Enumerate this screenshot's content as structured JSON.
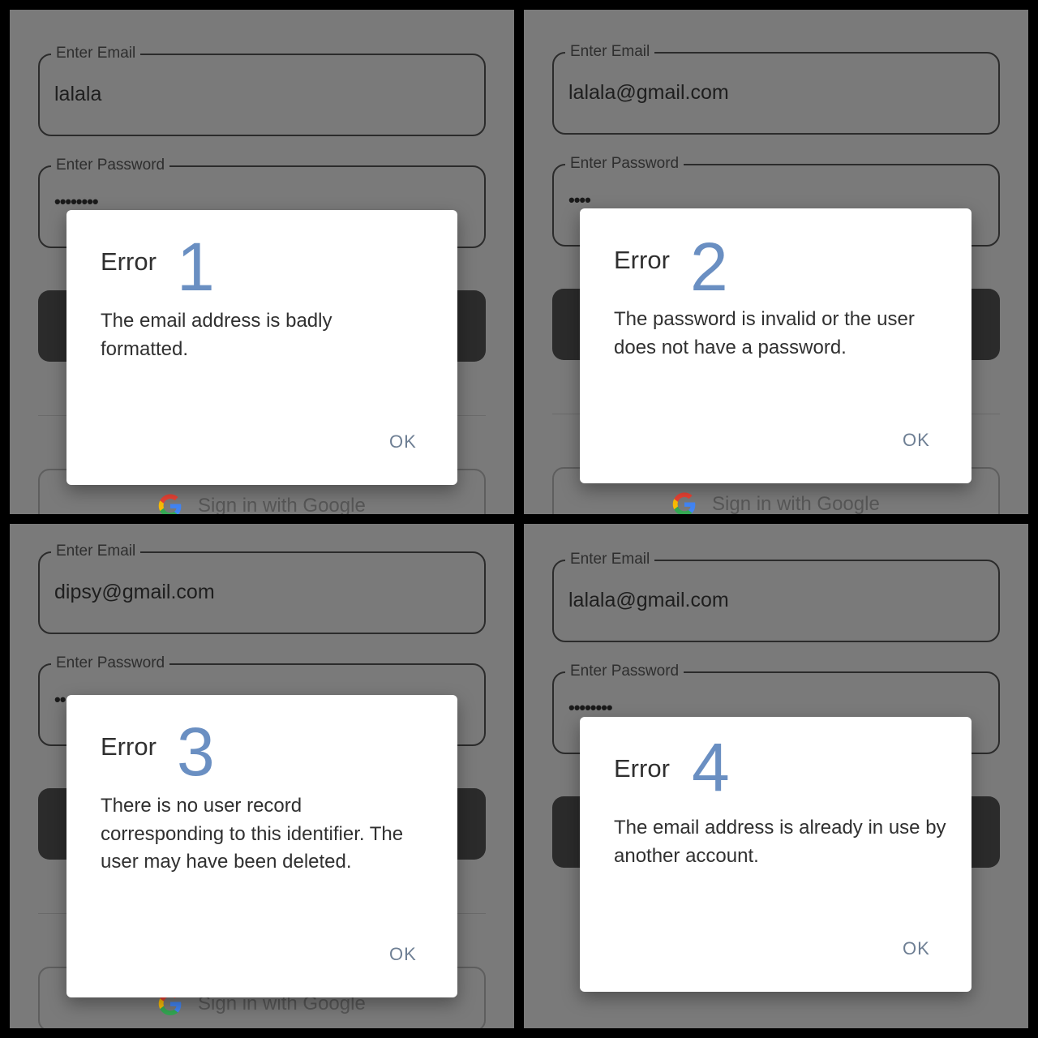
{
  "colors": {
    "number_accent": "#6a8fc2",
    "dialog_bg": "#ffffff",
    "panel_bg": "#7a7a7a",
    "ok_text": "#6e7f94"
  },
  "panels": [
    {
      "email_label": "Enter Email",
      "email_value": "lalala",
      "password_label": "Enter Password",
      "password_mask": "••••••••",
      "google_label": "Sign in with Google",
      "dialog": {
        "title": "Error",
        "number": "1",
        "message": "The email address is badly formatted.",
        "ok": "OK"
      }
    },
    {
      "email_label": "Enter Email",
      "email_value": "lalala@gmail.com",
      "password_label": "Enter Password",
      "password_mask": "••••",
      "google_label": "Sign in with Google",
      "dialog": {
        "title": "Error",
        "number": "2",
        "message": "The password is invalid or the user does not have a password.",
        "ok": "OK"
      }
    },
    {
      "email_label": "Enter Email",
      "email_value": "dipsy@gmail.com",
      "password_label": "Enter Password",
      "password_mask": "••",
      "google_label": "Sign in with Google",
      "dialog": {
        "title": "Error",
        "number": "3",
        "message": "There is no user record corresponding to this identifier. The user may have been deleted.",
        "ok": "OK"
      }
    },
    {
      "email_label": "Enter Email",
      "email_value": "lalala@gmail.com",
      "password_label": "Enter Password",
      "password_mask": "••••••••",
      "dialog": {
        "title": "Error",
        "number": "4",
        "message": "The email address is already in use by another account.",
        "ok": "OK"
      }
    }
  ]
}
